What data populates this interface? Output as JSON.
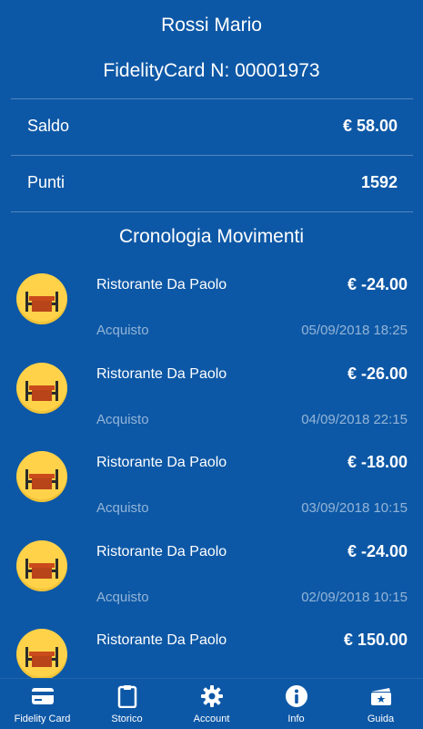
{
  "header": {
    "name": "Rossi Mario",
    "card": "FidelityCard N: 00001973"
  },
  "summary": {
    "saldo_label": "Saldo",
    "saldo_value": "€ 58.00",
    "punti_label": "Punti",
    "punti_value": "1592"
  },
  "history": {
    "title": "Cronologia Movimenti",
    "items": [
      {
        "merchant": "Ristorante Da Paolo",
        "amount": "€ -24.00",
        "type": "Acquisto",
        "date": "05/09/2018 18:25",
        "icon": "restaurant-icon"
      },
      {
        "merchant": "Ristorante Da Paolo",
        "amount": "€ -26.00",
        "type": "Acquisto",
        "date": "04/09/2018 22:15",
        "icon": "restaurant-icon"
      },
      {
        "merchant": "Ristorante Da Paolo",
        "amount": "€ -18.00",
        "type": "Acquisto",
        "date": "03/09/2018 10:15",
        "icon": "restaurant-icon"
      },
      {
        "merchant": "Ristorante Da Paolo",
        "amount": "€ -24.00",
        "type": "Acquisto",
        "date": "02/09/2018 10:15",
        "icon": "restaurant-icon"
      },
      {
        "merchant": "Ristorante Da Paolo",
        "amount": "€ 150.00",
        "type": "",
        "date": "",
        "icon": "restaurant-icon"
      }
    ]
  },
  "tabs": [
    {
      "label": "Fidelity Card",
      "icon": "credit-card-icon"
    },
    {
      "label": "Storico",
      "icon": "clipboard-icon"
    },
    {
      "label": "Account",
      "icon": "gear-icon"
    },
    {
      "label": "Info",
      "icon": "info-icon"
    },
    {
      "label": "Guida",
      "icon": "ticket-icon"
    }
  ],
  "colors": {
    "background": "#0d58a6",
    "icon_circle": "#ffd24a",
    "text": "#ffffff"
  }
}
